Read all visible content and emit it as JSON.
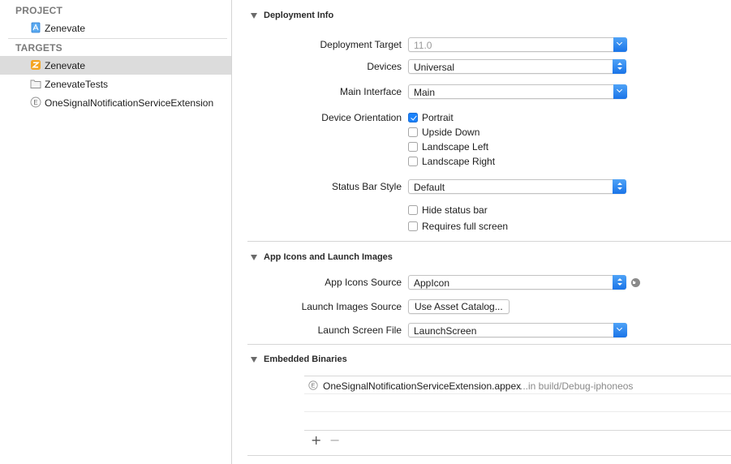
{
  "sidebar": {
    "project_header": "PROJECT",
    "project_item": {
      "label": "Zenevate",
      "icon": "xcode-project-icon"
    },
    "targets_header": "TARGETS",
    "targets": [
      {
        "label": "Zenevate",
        "icon": "app-target-icon",
        "selected": true
      },
      {
        "label": "ZenevateTests",
        "icon": "test-bundle-icon",
        "selected": false
      },
      {
        "label": "OneSignalNotificationServiceExtension",
        "icon": "extension-icon",
        "selected": false
      }
    ]
  },
  "deployment_info": {
    "title": "Deployment Info",
    "deployment_target_label": "Deployment Target",
    "deployment_target_value": "11.0",
    "devices_label": "Devices",
    "devices_value": "Universal",
    "main_interface_label": "Main Interface",
    "main_interface_value": "Main",
    "device_orientation_label": "Device Orientation",
    "orientations": [
      {
        "label": "Portrait",
        "checked": true
      },
      {
        "label": "Upside Down",
        "checked": false
      },
      {
        "label": "Landscape Left",
        "checked": false
      },
      {
        "label": "Landscape Right",
        "checked": false
      }
    ],
    "status_bar_style_label": "Status Bar Style",
    "status_bar_style_value": "Default",
    "hide_status_bar_label": "Hide status bar",
    "requires_full_screen_label": "Requires full screen"
  },
  "app_icons": {
    "title": "App Icons and Launch Images",
    "app_icons_source_label": "App Icons Source",
    "app_icons_source_value": "AppIcon",
    "launch_images_source_label": "Launch Images Source",
    "launch_images_button": "Use Asset Catalog...",
    "launch_screen_file_label": "Launch Screen File",
    "launch_screen_file_value": "LaunchScreen"
  },
  "embedded_binaries": {
    "title": "Embedded Binaries",
    "rows": [
      {
        "name": "OneSignalNotificationServiceExtension.appex",
        "path": "...in build/Debug-iphoneos"
      }
    ],
    "add_symbol": "+",
    "remove_symbol": "−"
  },
  "colors": {
    "accent": "#1a82fb",
    "selection": "#dcdcdc",
    "header_gray": "#7a7a7a"
  }
}
